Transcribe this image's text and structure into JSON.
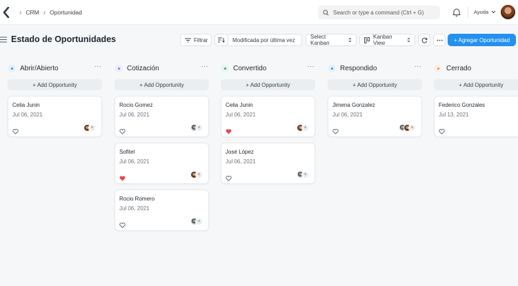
{
  "breadcrumbs": [
    "CRM",
    "Oportunidad"
  ],
  "search": {
    "placeholder": "Search or type a command (Ctrl + G)"
  },
  "help_label": "Ayuda",
  "page_title": "Estado de Oportunidades",
  "toolbar": {
    "filter_label": "Filtrar",
    "sort_label": "Modificada por última vez",
    "select_kanban_label": "Select Kanban",
    "view_label": "Kanban View",
    "add_label": "+ Agregar Oportunidad"
  },
  "add_card_label": "+ Add Opportunity",
  "colors": {
    "primary": "#2490ef",
    "heart_liked": "#e24c4c"
  },
  "columns": [
    {
      "title": "Abrir/Abierto",
      "indicator": "#2490ef",
      "indicator_bg": "#e3f1fd",
      "cards": [
        {
          "name": "Celia Junin",
          "date": "Jul 06, 2021",
          "liked": false,
          "avatars": [
            "brown"
          ]
        }
      ]
    },
    {
      "title": "Cotización",
      "indicator": "#8e73e5",
      "indicator_bg": "#efeafd",
      "cards": [
        {
          "name": "Rocio Gomez",
          "date": "Jul 06, 2021",
          "liked": false,
          "avatars": [
            "gray"
          ]
        },
        {
          "name": "Sofitel",
          "date": "Jul 06, 2021",
          "liked": true,
          "avatars": [
            "brown"
          ]
        },
        {
          "name": "Rocio Romero",
          "date": "Jul 06, 2021",
          "liked": false,
          "avatars": [
            "gray"
          ]
        }
      ]
    },
    {
      "title": "Convertido",
      "indicator": "#39a36a",
      "indicator_bg": "#e4f5ea",
      "cards": [
        {
          "name": "Celia Junin",
          "date": "Jul 06, 2021",
          "liked": true,
          "avatars": [
            "brown"
          ]
        },
        {
          "name": "José López",
          "date": "Jul 06, 2021",
          "liked": false,
          "avatars": [
            "gray"
          ]
        }
      ]
    },
    {
      "title": "Respondido",
      "indicator": "#2490ef",
      "indicator_bg": "#e3f1fd",
      "cards": [
        {
          "name": "Jimena Gonzalez",
          "date": "Jul 06, 2021",
          "liked": false,
          "avatars": [
            "gray",
            "brown"
          ]
        }
      ]
    },
    {
      "title": "Cerrado",
      "indicator": "#f08a4b",
      "indicator_bg": "#fdeee4",
      "cards": [
        {
          "name": "Federico Gonzales",
          "date": "Jul 13, 2021",
          "liked": false,
          "avatars": []
        }
      ]
    }
  ]
}
